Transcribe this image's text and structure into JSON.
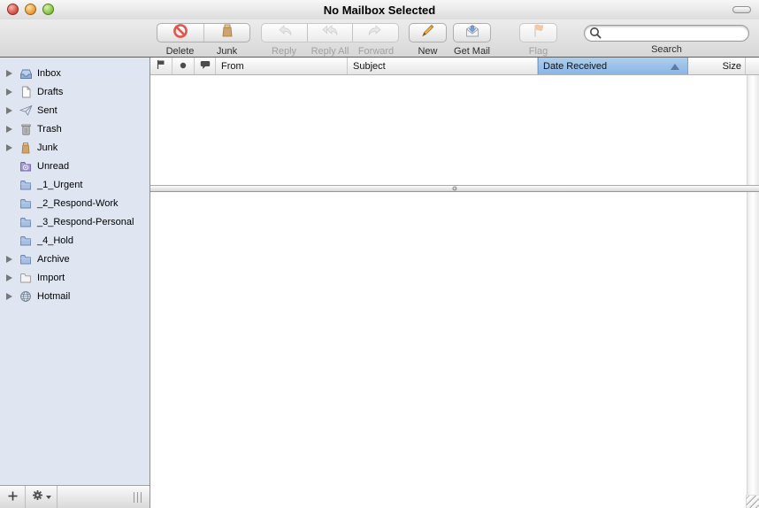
{
  "window": {
    "title": "No Mailbox Selected"
  },
  "toolbar": {
    "buttons": [
      {
        "label": "Delete",
        "icon": "delete-icon",
        "enabled": true
      },
      {
        "label": "Junk",
        "icon": "junk-icon",
        "enabled": true
      },
      {
        "label": "Reply",
        "icon": "reply-icon",
        "enabled": false
      },
      {
        "label": "Reply All",
        "icon": "reply-all-icon",
        "enabled": false
      },
      {
        "label": "Forward",
        "icon": "forward-icon",
        "enabled": false
      },
      {
        "label": "New",
        "icon": "compose-icon",
        "enabled": true
      },
      {
        "label": "Get Mail",
        "icon": "get-mail-icon",
        "enabled": true
      },
      {
        "label": "Flag",
        "icon": "flag-icon",
        "enabled": false
      }
    ],
    "search": {
      "label": "Search",
      "value": "",
      "placeholder": "",
      "icon": "search-icon"
    }
  },
  "sidebar": {
    "items": [
      {
        "label": "Inbox",
        "icon": "inbox-icon",
        "disclosure": true
      },
      {
        "label": "Drafts",
        "icon": "drafts-icon",
        "disclosure": true
      },
      {
        "label": "Sent",
        "icon": "sent-icon",
        "disclosure": true
      },
      {
        "label": "Trash",
        "icon": "trash-icon",
        "disclosure": true
      },
      {
        "label": "Junk",
        "icon": "junk-bag-icon",
        "disclosure": true
      },
      {
        "label": "Unread",
        "icon": "smart-mailbox-icon",
        "disclosure": false
      },
      {
        "label": "_1_Urgent",
        "icon": "folder-blue-icon",
        "disclosure": false
      },
      {
        "label": "_2_Respond-Work",
        "icon": "folder-blue-icon",
        "disclosure": false
      },
      {
        "label": "_3_Respond-Personal",
        "icon": "folder-blue-icon",
        "disclosure": false
      },
      {
        "label": "_4_Hold",
        "icon": "folder-blue-icon",
        "disclosure": false
      },
      {
        "label": "Archive",
        "icon": "folder-blue-icon",
        "disclosure": true
      },
      {
        "label": "Import",
        "icon": "folder-plain-icon",
        "disclosure": true
      },
      {
        "label": "Hotmail",
        "icon": "globe-icon",
        "disclosure": true
      }
    ],
    "footer": {
      "buttons": [
        {
          "icon": "plus-icon",
          "name": "add-mailbox"
        },
        {
          "icon": "gear-icon",
          "name": "action-menu",
          "has_menu": true
        }
      ]
    }
  },
  "message_list": {
    "columns": [
      {
        "name": "flag",
        "icon": "flag-column-icon"
      },
      {
        "name": "status",
        "icon": "unread-dot-icon"
      },
      {
        "name": "note",
        "icon": "note-bubble-icon"
      },
      {
        "name": "from",
        "label": "From"
      },
      {
        "name": "subject",
        "label": "Subject"
      },
      {
        "name": "date",
        "label": "Date Received",
        "selected": true,
        "sort": "ascending"
      },
      {
        "name": "size",
        "label": "Size"
      }
    ],
    "rows": []
  },
  "colors": {
    "sidebar_bg": "#dfe6f2",
    "selected_header_blue": "#8ab5e5",
    "delete_red": "#e0584d",
    "flag_orange": "#f0a05c",
    "junk_brown": "#cfa36b"
  }
}
